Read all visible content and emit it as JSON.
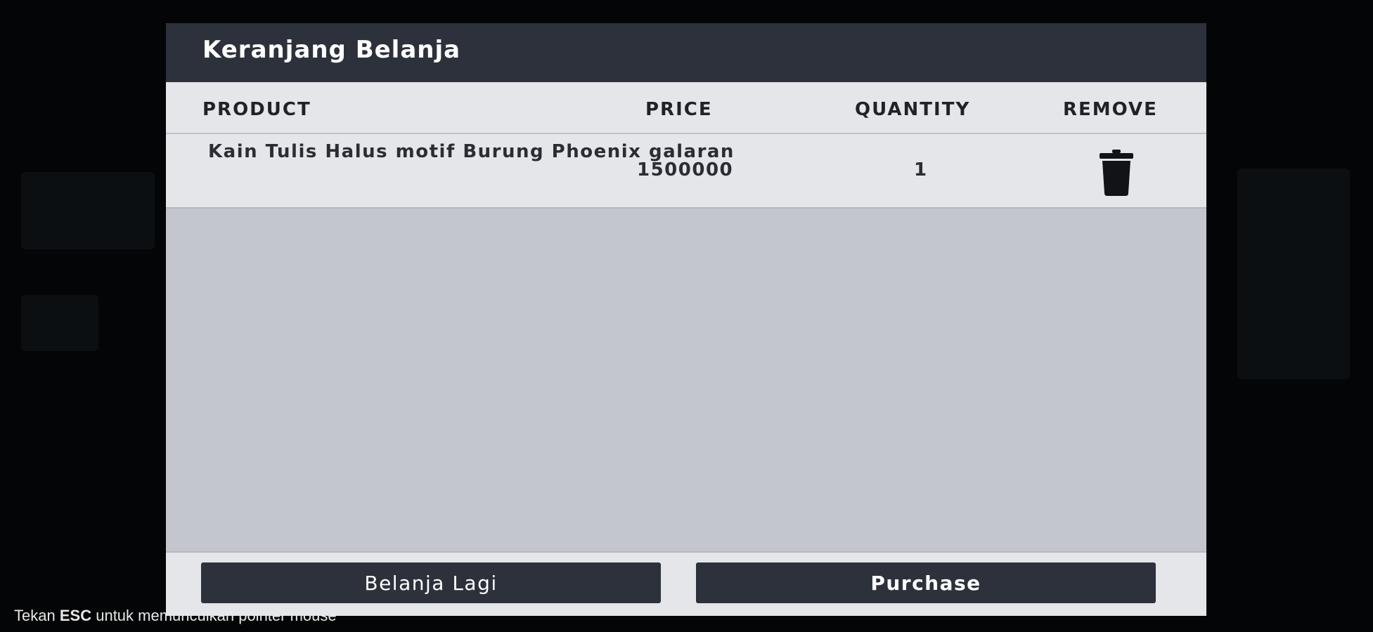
{
  "dialog": {
    "title": "Keranjang Belanja"
  },
  "table": {
    "columns": [
      "PRODUCT",
      "PRICE",
      "QUANTITY",
      "REMOVE"
    ],
    "rows": [
      {
        "product": "Kain Tulis Halus motif Burung Phoenix galaran",
        "price": "1500000",
        "quantity": "1",
        "remove_icon": "trash-icon"
      }
    ]
  },
  "buttons": {
    "continue_label": "Belanja Lagi",
    "purchase_label": "Purchase"
  },
  "hint": {
    "prefix": "Tekan",
    "key": "ESC",
    "suffix": "untuk memunculkan pointer mouse"
  },
  "colors": {
    "panel_dark": "#2d313b",
    "panel_light": "#e4e6ea",
    "panel_body": "#c3c6cd",
    "background": "#050607"
  }
}
